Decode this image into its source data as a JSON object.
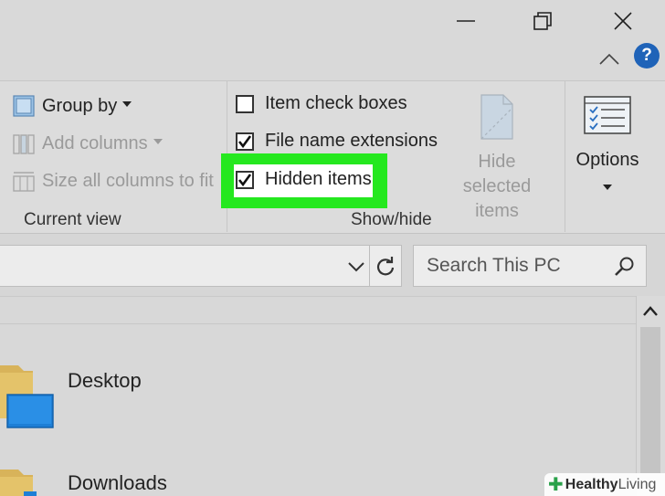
{
  "ribbon": {
    "group_by": "Group by",
    "add_columns": "Add columns",
    "size_all_columns": "Size all columns to fit",
    "current_view_label": "Current view",
    "item_check_boxes": "Item check boxes",
    "file_name_extensions": "File name extensions",
    "hidden_items": "Hidden items",
    "show_hide_label": "Show/hide",
    "hide_selected_line1": "Hide selected",
    "hide_selected_line2": "items",
    "options": "Options",
    "checked": {
      "item_check_boxes": false,
      "file_name_extensions": true,
      "hidden_items": true
    }
  },
  "titlebar": {
    "help_glyph": "?"
  },
  "search": {
    "placeholder": "Search This PC"
  },
  "files": [
    {
      "name": "Desktop"
    },
    {
      "name": "Downloads"
    }
  ],
  "watermark": {
    "part1": "Healthy",
    "part2": "Living"
  },
  "colors": {
    "highlight": "#25e81f",
    "help": "#1f63b8",
    "folder": "#d8b35a",
    "desktop_blue": "#1e7fd6"
  }
}
